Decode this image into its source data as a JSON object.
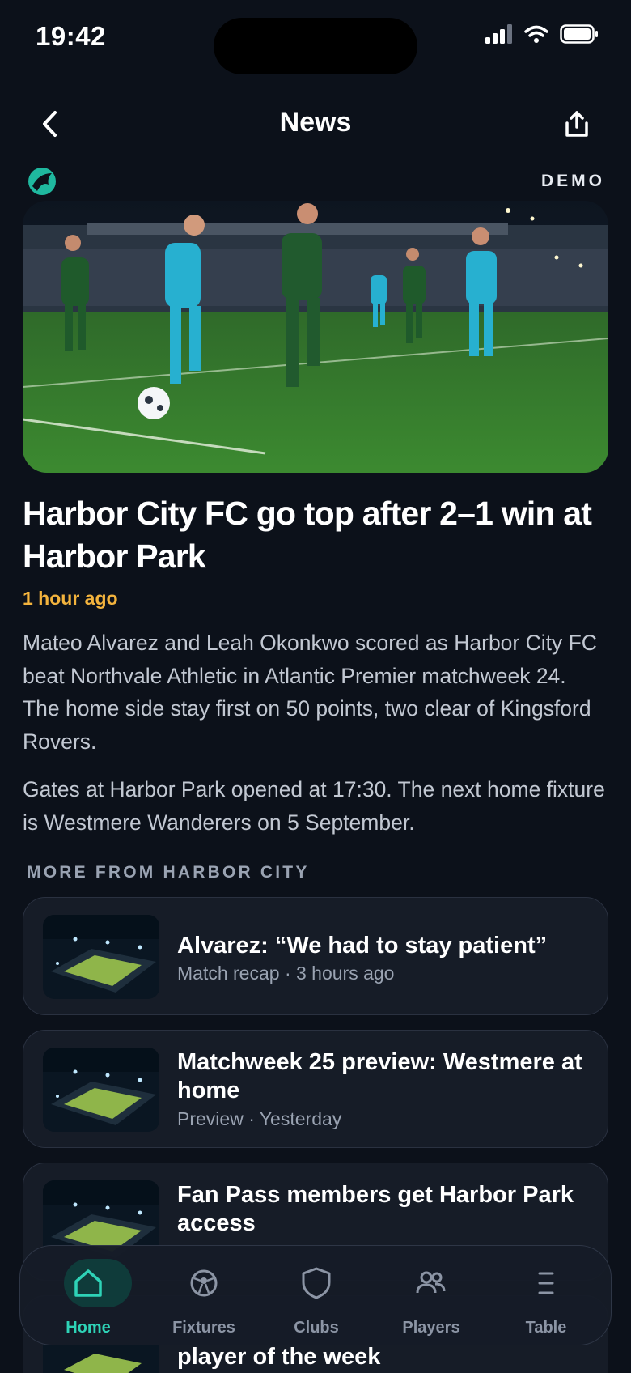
{
  "status": {
    "time": "19:42"
  },
  "header": {
    "title": "News"
  },
  "brand": {
    "tag": "DEMO"
  },
  "article": {
    "headline": "Harbor City FC go top after 2–1 win at Harbor Park",
    "time": "1 hour ago",
    "paragraphs": [
      "Mateo Alvarez and Leah Okonkwo scored as Harbor City FC beat Northvale Athletic in Atlantic Premier matchweek 24. The home side stay first on 50 points, two clear of Kingsford Rovers.",
      "Gates at Harbor Park opened at 17:30. The next home fixture is Westmere Wanderers on 5 September."
    ]
  },
  "more": {
    "label": "MORE FROM HARBOR CITY",
    "items": [
      {
        "title": "Alvarez: “We had to stay patient”",
        "meta": "Match recap · 3 hours ago"
      },
      {
        "title": "Matchweek 25 preview: Westmere at home",
        "meta": "Preview · Yesterday"
      },
      {
        "title": "Fan Pass members get Harbor Park access",
        "meta": ""
      },
      {
        "title": "player of the week",
        "meta": ""
      }
    ]
  },
  "tabs": [
    {
      "label": "Home",
      "icon": "home-icon",
      "active": true
    },
    {
      "label": "Fixtures",
      "icon": "ball-icon",
      "active": false
    },
    {
      "label": "Clubs",
      "icon": "shield-icon",
      "active": false
    },
    {
      "label": "Players",
      "icon": "people-icon",
      "active": false
    },
    {
      "label": "Table",
      "icon": "table-icon",
      "active": false
    }
  ],
  "colors": {
    "accent": "#2ed3b7",
    "time_highlight": "#f3b33d",
    "background": "#0c111a"
  }
}
